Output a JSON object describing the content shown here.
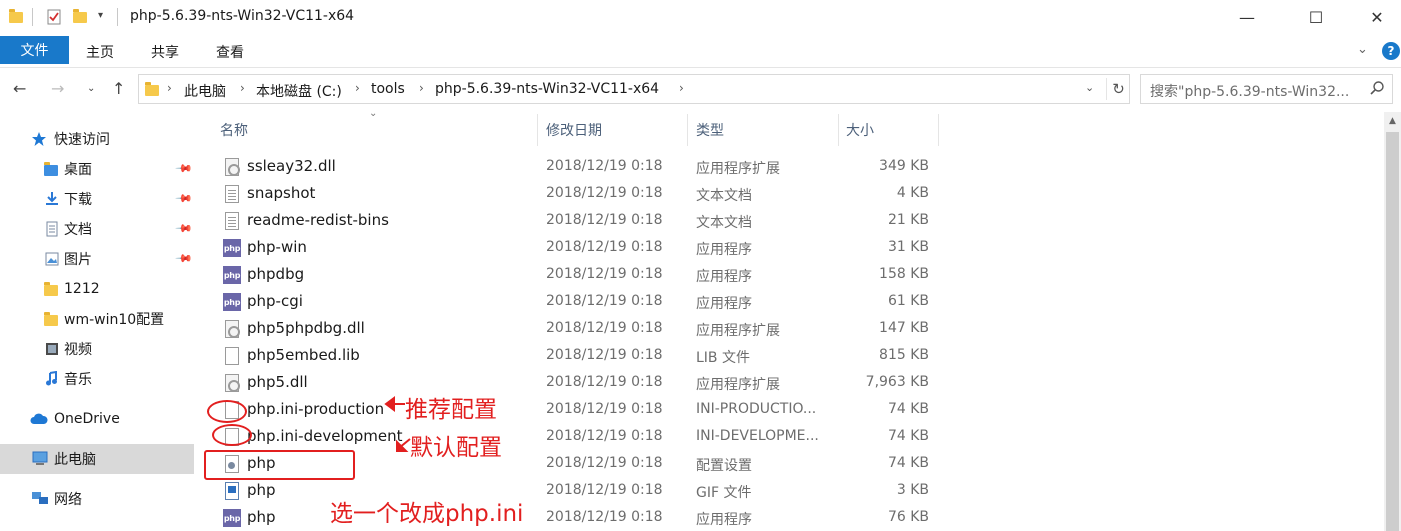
{
  "window": {
    "title": "php-5.6.39-nts-Win32-VC11-x64",
    "minimize_glyph": "—",
    "maximize_glyph": "☐",
    "close_glyph": "✕"
  },
  "ribbon": {
    "file_tab": "文件",
    "tabs": [
      "主页",
      "共享",
      "查看"
    ],
    "help": "?"
  },
  "address": {
    "crumbs": [
      "此电脑",
      "本地磁盘 (C:)",
      "tools",
      "php-5.6.39-nts-Win32-VC11-x64"
    ],
    "search_placeholder": "搜索\"php-5.6.39-nts-Win32..."
  },
  "nav": {
    "quick_access": "快速访问",
    "items": [
      {
        "label": "桌面",
        "pinned": true
      },
      {
        "label": "下载",
        "pinned": true
      },
      {
        "label": "文档",
        "pinned": true
      },
      {
        "label": "图片",
        "pinned": true
      },
      {
        "label": "1212",
        "pinned": false
      },
      {
        "label": "wm-win10配置",
        "pinned": false
      },
      {
        "label": "视频",
        "pinned": false
      },
      {
        "label": "音乐",
        "pinned": false
      }
    ],
    "onedrive": "OneDrive",
    "this_pc": "此电脑",
    "network": "网络"
  },
  "columns": {
    "name": "名称",
    "date": "修改日期",
    "type": "类型",
    "size": "大小"
  },
  "files": [
    {
      "name": "ssleay32.dll",
      "date": "2018/12/19 0:18",
      "type": "应用程序扩展",
      "size": "349 KB",
      "icon": "dll-icon"
    },
    {
      "name": "snapshot",
      "date": "2018/12/19 0:18",
      "type": "文本文档",
      "size": "4 KB",
      "icon": "text-document-icon"
    },
    {
      "name": "readme-redist-bins",
      "date": "2018/12/19 0:18",
      "type": "文本文档",
      "size": "21 KB",
      "icon": "text-document-icon"
    },
    {
      "name": "php-win",
      "date": "2018/12/19 0:18",
      "type": "应用程序",
      "size": "31 KB",
      "icon": "php-app-icon"
    },
    {
      "name": "phpdbg",
      "date": "2018/12/19 0:18",
      "type": "应用程序",
      "size": "158 KB",
      "icon": "php-app-icon"
    },
    {
      "name": "php-cgi",
      "date": "2018/12/19 0:18",
      "type": "应用程序",
      "size": "61 KB",
      "icon": "php-app-icon"
    },
    {
      "name": "php5phpdbg.dll",
      "date": "2018/12/19 0:18",
      "type": "应用程序扩展",
      "size": "147 KB",
      "icon": "dll-icon"
    },
    {
      "name": "php5embed.lib",
      "date": "2018/12/19 0:18",
      "type": "LIB 文件",
      "size": "815 KB",
      "icon": "blank-file-icon"
    },
    {
      "name": "php5.dll",
      "date": "2018/12/19 0:18",
      "type": "应用程序扩展",
      "size": "7,963 KB",
      "icon": "dll-icon"
    },
    {
      "name": "php.ini-production",
      "date": "2018/12/19 0:18",
      "type": "INI-PRODUCTIO...",
      "size": "74 KB",
      "icon": "blank-file-icon"
    },
    {
      "name": "php.ini-development",
      "date": "2018/12/19 0:18",
      "type": "INI-DEVELOPME...",
      "size": "74 KB",
      "icon": "blank-file-icon"
    },
    {
      "name": "php",
      "date": "2018/12/19 0:18",
      "type": "配置设置",
      "size": "74 KB",
      "icon": "config-settings-icon"
    },
    {
      "name": "php",
      "date": "2018/12/19 0:18",
      "type": "GIF 文件",
      "size": "3 KB",
      "icon": "gif-image-icon"
    },
    {
      "name": "php",
      "date": "2018/12/19 0:18",
      "type": "应用程序",
      "size": "76 KB",
      "icon": "php-app-icon"
    }
  ],
  "annotations": {
    "recommended": "推荐配置",
    "default": "默认配置",
    "instruction": "选一个改成php.ini",
    "color": "#e21f1f"
  }
}
